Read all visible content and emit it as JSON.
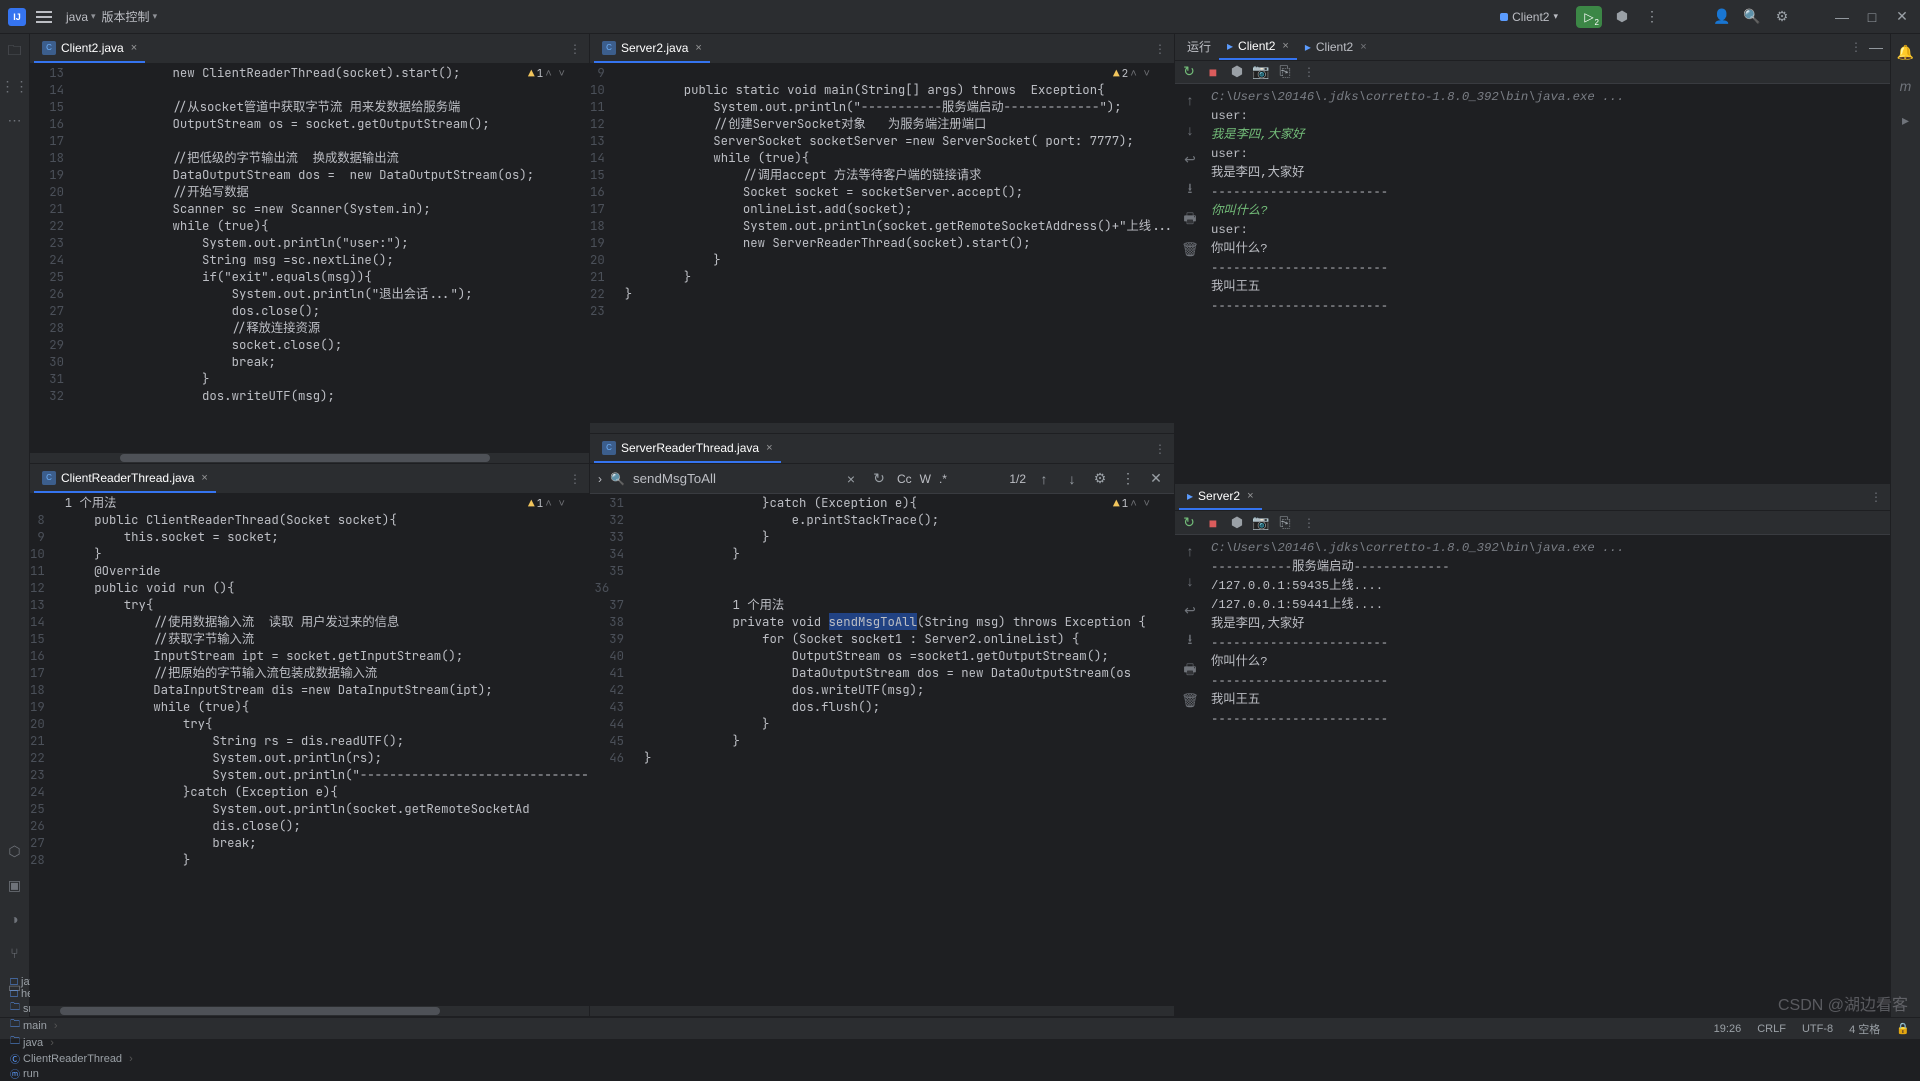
{
  "titlebar": {
    "menu1": "java",
    "menu2": "版本控制",
    "runConfig": "Client2",
    "runBadge": "2"
  },
  "topright_icons": [
    "person",
    "search",
    "settings",
    "min",
    "max",
    "close"
  ],
  "tabs": {
    "client2": "Client2.java",
    "server2": "Server2.java",
    "clientReader": "ClientReaderThread.java",
    "serverReader": "ServerReaderThread.java"
  },
  "warnings": {
    "client2": "1",
    "server2": "2",
    "clientReader": "1",
    "serverReader": "1"
  },
  "search": {
    "term": "sendMsgToAll",
    "count": "1/2",
    "toggles": [
      "Cc",
      "W",
      ".*"
    ]
  },
  "usageHint": "1 个用法",
  "code": {
    "client2": [
      [
        13,
        "            <kw>new</kw> <fn>ClientReaderThread</fn>(socket).start();"
      ],
      [
        14,
        ""
      ],
      [
        15,
        "            <cm>//从socket管道中获取字节流 用来发数据给服务端</cm>"
      ],
      [
        16,
        "            OutputStream os = socket.getOutputStream();"
      ],
      [
        17,
        ""
      ],
      [
        18,
        "            <cm>//把低级的字节输出流  换成数据输出流</cm>"
      ],
      [
        19,
        "            DataOutputStream dos =  <kw>new</kw> DataOutputStream(os);"
      ],
      [
        20,
        "            <cm>//开始写数据</cm>"
      ],
      [
        21,
        "            Scanner sc =<kw>new</kw> Scanner(System.<fld>in</fld>);"
      ],
      [
        22,
        "            <kw>while</kw> (<kw>true</kw>){"
      ],
      [
        23,
        "                System.<fld>out</fld>.println(<str>\"user:\"</str>);"
      ],
      [
        24,
        "                String msg =sc.nextLine();"
      ],
      [
        25,
        "                <kw>if</kw>(<str>\"exit\"</str>.equals(msg)){"
      ],
      [
        26,
        "                    System.<fld>out</fld>.println(<str>\"退出会话...\"</str>);"
      ],
      [
        27,
        "                    dos.close();"
      ],
      [
        28,
        "                    <cm>//释放连接资源</cm>"
      ],
      [
        29,
        "                    socket.close();"
      ],
      [
        30,
        "                    <kw>break</kw>;"
      ],
      [
        31,
        "                }"
      ],
      [
        32,
        "                dos.writeUTF(msg);"
      ]
    ],
    "server2": [
      [
        9,
        ""
      ],
      [
        10,
        "        <kw>public</kw> <kw>static</kw> <kw>void</kw> <fn>main</fn>(String[] args) <kw>throws</kw>  Exception{"
      ],
      [
        11,
        "            System.<fld>out</fld>.println(<str>\"-----------服务端启动-------------\"</str>);"
      ],
      [
        12,
        "            <cm>//创建ServerSocket对象   为服务端注册端口</cm>"
      ],
      [
        13,
        "            ServerSocket socketServer =<kw>new</kw> <fn>ServerSocket</fn>( <hint>port:</hint> <num>7777</num>);"
      ],
      [
        14,
        "            <kw>while</kw> (<kw>true</kw>){"
      ],
      [
        15,
        "                <cm>//调用accept 方法等待客户端的链接请求</cm>"
      ],
      [
        16,
        "                Socket socket = socketServer.accept();"
      ],
      [
        17,
        "                <fld>onlineList</fld>.add(socket);"
      ],
      [
        18,
        "                System.<fld>out</fld>.println(socket.getRemoteSocketAddress()+<str>\"上线...\"</str>"
      ],
      [
        19,
        "                <kw>new</kw> <fn>ServerReaderThread</fn>(socket).start();"
      ],
      [
        20,
        "            }"
      ],
      [
        21,
        "        }"
      ],
      [
        22,
        "}"
      ],
      [
        23,
        ""
      ]
    ],
    "clientReader": [
      [
        "",
        "<hint>1 个用法</hint>"
      ],
      [
        8,
        "    <kw>public</kw> <fn>ClientReaderThread</fn>(Socket socket){"
      ],
      [
        9,
        "        <kw>this</kw>.<fld>socket</fld> = socket;"
      ],
      [
        10,
        "    }"
      ],
      [
        11,
        "    <it>@Override</it>"
      ],
      [
        12,
        "    <kw>public</kw> <kw>void</kw> <fn>run</fn> (){"
      ],
      [
        13,
        "        <kw>try</kw>{"
      ],
      [
        14,
        "            <cm>//使用数据输入流  读取 用户发过来的信息</cm>"
      ],
      [
        15,
        "            <cm>//获取字节输入流</cm>"
      ],
      [
        16,
        "            InputStream ipt = <fld>socket</fld>.getInputStream();"
      ],
      [
        17,
        "            <cm>//把原始的字节输入流包装成数据输入流</cm>"
      ],
      [
        18,
        "            DataInputStream dis =<kw>new</kw> DataInputStream(ipt);"
      ],
      [
        19,
        "            <kw>while</kw> (<kw>true</kw>){"
      ],
      [
        20,
        "                <kw>try</kw>{"
      ],
      [
        21,
        "                    String rs = dis.readUTF();"
      ],
      [
        22,
        "                    System.<fld>out</fld>.println(rs);"
      ],
      [
        23,
        "                    System.<fld>out</fld>.println(<str>\"--------------------------------\"</str>"
      ],
      [
        24,
        "                }<kw>catch</kw> (Exception e){"
      ],
      [
        25,
        "                    System.<fld>out</fld>.println(<fld>socket</fld>.getRemoteSocketAd"
      ],
      [
        26,
        "                    dis.close();"
      ],
      [
        27,
        "                    <kw>break</kw>;"
      ],
      [
        28,
        "                }"
      ]
    ],
    "serverReader": [
      [
        31,
        "                }<kw>catch</kw> (Exception e){"
      ],
      [
        32,
        "                    e.printStackTrace();"
      ],
      [
        33,
        "                }"
      ],
      [
        34,
        "            }"
      ],
      [
        35,
        ""
      ],
      [
        36,
        ""
      ],
      [
        "",
        "            <hint>1 个用法</hint>"
      ],
      [
        37,
        "            <kw>private</kw> <kw>void</kw> <span class='highlight'>sendMsgToAll</span>(String msg) <kw>throws</kw> Exception {"
      ],
      [
        38,
        "                <kw>for</kw> (Socket socket1 : Server2.<fld>onlineList</fld>) {"
      ],
      [
        39,
        "                    OutputStream os =socket1.getOutputStream();"
      ],
      [
        40,
        "                    DataOutputStream dos = <kw>new</kw> DataOutputStream(os"
      ],
      [
        41,
        "                    dos.writeUTF(msg);"
      ],
      [
        42,
        "                    dos.flush();"
      ],
      [
        43,
        "                }"
      ],
      [
        44,
        "            }"
      ],
      [
        45,
        "}"
      ],
      [
        46,
        ""
      ]
    ]
  },
  "run": {
    "tab_label": "运行",
    "tab1": "Client2",
    "tab2": "Client2",
    "tab3": "Server2",
    "console1": [
      "<span class='itg'>C:\\Users\\20146\\.jdks\\corretto-1.8.0_392\\bin\\java.exe ...</span>",
      "user:",
      "<span class='grn it'>我是李四,大家好</span>",
      "user:",
      "我是李四,大家好",
      "------------------------",
      "<span class='grn it'>你叫什么?</span>",
      "user:",
      "你叫什么?",
      "------------------------",
      "我叫王五",
      "------------------------"
    ],
    "console2": [
      "<span class='itg'>C:\\Users\\20146\\.jdks\\corretto-1.8.0_392\\bin\\java.exe ...</span>",
      "-----------服务端启动-------------",
      "/127.0.0.1:59435上线....",
      "/127.0.0.1:59441上线....",
      "我是李四,大家好",
      "------------------------",
      "你叫什么?",
      "------------------------",
      "我叫王五",
      "------------------------"
    ]
  },
  "breadcrumbs": [
    "java",
    "hello",
    "src",
    "main",
    "java",
    "ClientReaderThread",
    "run"
  ],
  "status": {
    "pos": "19:26",
    "sep": "CRLF",
    "enc": "UTF-8",
    "indent": "4 空格"
  },
  "watermark": "CSDN @湖边看客"
}
